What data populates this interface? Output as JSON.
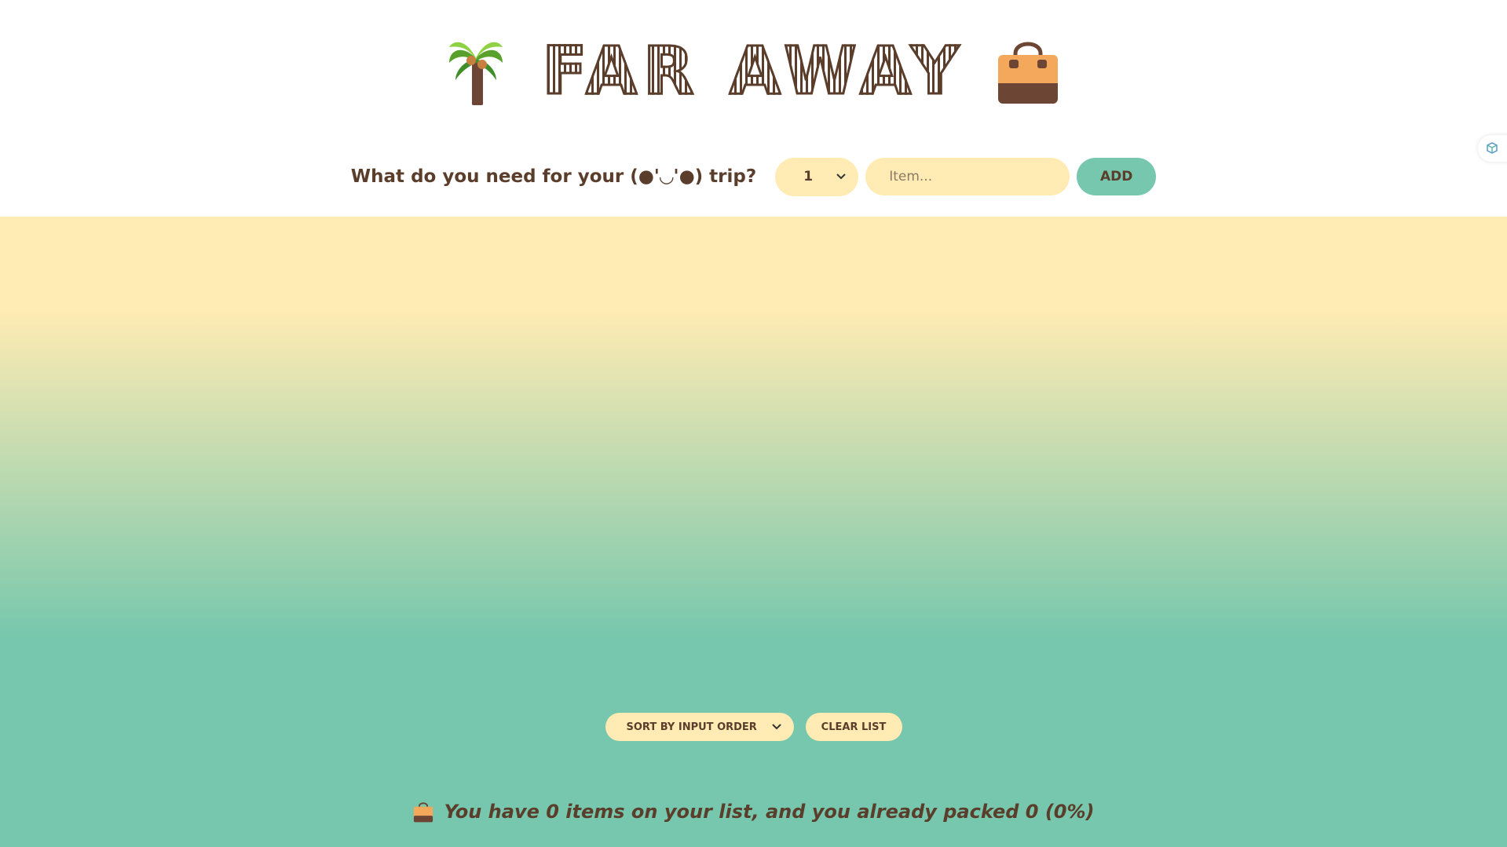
{
  "header": {
    "title": "FAR AWAY",
    "left_icon": "palm-tree-icon",
    "right_icon": "handbag-icon"
  },
  "form": {
    "question": "What do you need for your (●'◡'●) trip?",
    "quantity_value": "1",
    "item_placeholder": "Item...",
    "add_label": "ADD"
  },
  "list": {
    "items": [],
    "sort_value": "SORT BY INPUT ORDER",
    "clear_label": "CLEAR LIST"
  },
  "stats": {
    "icon": "handbag-icon",
    "text": "You have 0 items on your list, and you already packed 0 (0%)"
  },
  "colors": {
    "brown": "#5a3e2b",
    "cream": "#ffebb3",
    "mint": "#76c7ad",
    "white": "#ffffff"
  }
}
